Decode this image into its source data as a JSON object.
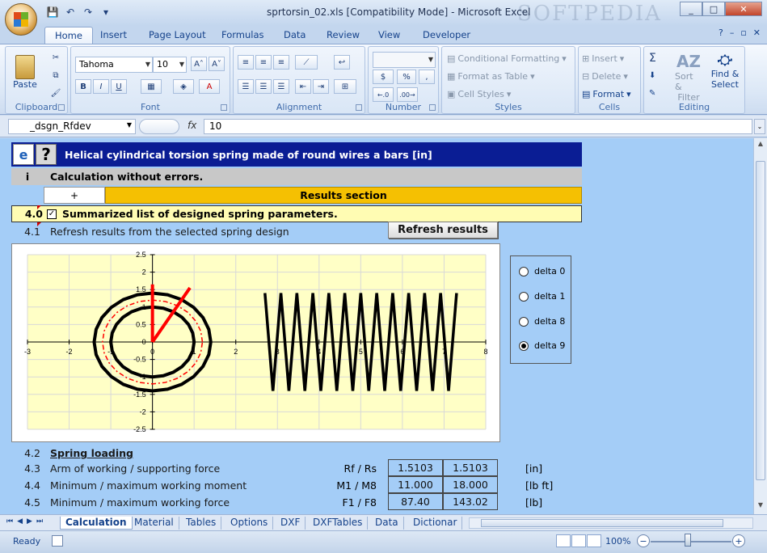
{
  "window": {
    "title": "sprtorsin_02.xls  [Compatibility Mode] - Microsoft Excel",
    "watermark": "SOFTPEDIA"
  },
  "qat": {
    "save": "💾",
    "undo": "↶",
    "redo": "↷",
    "more": "▾"
  },
  "ribbon_tabs": [
    "Home",
    "Insert",
    "Page Layout",
    "Formulas",
    "Data",
    "Review",
    "View",
    "Developer"
  ],
  "clipboard": {
    "paste": "Paste",
    "label": "Clipboard"
  },
  "font": {
    "name": "Tahoma",
    "size": "10",
    "grow": "A˄",
    "shrink": "A˅",
    "bold": "B",
    "italic": "I",
    "underline": "U",
    "borders": "▦",
    "fill": "◈",
    "color": "A",
    "label": "Font"
  },
  "alignment": {
    "label": "Alignment"
  },
  "number": {
    "format": "",
    "currency": "$",
    "percent": "%",
    "comma": ",",
    "inc": "←.0",
    "dec": ".00→",
    "label": "Number"
  },
  "styles": {
    "conditional": "Conditional Formatting",
    "table": "Format as Table",
    "cell": "Cell Styles",
    "label": "Styles"
  },
  "cells": {
    "insert": "Insert",
    "delete": "Delete",
    "format": "Format",
    "label": "Cells"
  },
  "editing": {
    "sigma": "Σ",
    "sort": "Sort &",
    "filter": "Filter",
    "find": "Find &",
    "select": "Select",
    "label": "Editing"
  },
  "formula_bar": {
    "name_box": "_dsgn_Rfdev",
    "fx": "fx",
    "value": "10"
  },
  "sheet": {
    "header_title": "Helical cylindrical torsion spring made of round wires a bars [in]",
    "icon_e": "e",
    "icon_q": "?",
    "status_marker": "i",
    "status_text": "Calculation without errors.",
    "plus": "+",
    "results_section": "Results section",
    "summary_num": "4.0",
    "summary_check": "✓",
    "summary_text": "Summarized list of designed spring parameters.",
    "row41_num": "4.1",
    "row41_text": "Refresh results from the selected spring design",
    "refresh_button": "Refresh results",
    "row42_num": "4.2",
    "row42_text": "Spring loading",
    "row43_num": "4.3",
    "row43_text": "Arm of working / supporting force",
    "row43_sym": "Rf / Rs",
    "row43_v1": "1.5103",
    "row43_v2": "1.5103",
    "row43_unit": "[in]",
    "row44_num": "4.4",
    "row44_text": "Minimum / maximum working moment",
    "row44_sym": "M1 / M8",
    "row44_v1": "11.000",
    "row44_v2": "18.000",
    "row44_unit": "[lb ft]",
    "row45_num": "4.5",
    "row45_text": "Minimum / maximum working force",
    "row45_sym": "F1 / F8",
    "row45_v1": "87.40",
    "row45_v2": "143.02",
    "row45_unit": "[lb]"
  },
  "radio_options": [
    {
      "label": "delta 0",
      "selected": false
    },
    {
      "label": "delta 1",
      "selected": false
    },
    {
      "label": "delta 8",
      "selected": false
    },
    {
      "label": "delta 9",
      "selected": true
    }
  ],
  "chart_data": {
    "type": "line",
    "xlim": [
      -3,
      8
    ],
    "ylim": [
      -2.5,
      2.5
    ],
    "x_ticks": [
      "-3",
      "-2",
      "-1",
      "0",
      "1",
      "2",
      "3",
      "4",
      "5",
      "6",
      "7",
      "8"
    ],
    "y_ticks": [
      "2.5",
      "2",
      "1.5",
      "1",
      "0.5",
      "0",
      "-0.5",
      "-1",
      "-1.5",
      "-2",
      "-2.5"
    ],
    "grid": true,
    "outer_circle_radius": 1.4,
    "inner_circle_radius": 1.0,
    "mean_circle_radius": 1.2,
    "leg1": [
      [
        0,
        0
      ],
      [
        0,
        1.65
      ]
    ],
    "leg2": [
      [
        0,
        0
      ],
      [
        0.9,
        1.55
      ]
    ],
    "coil_x_range": [
      2.7,
      7.3
    ],
    "coil_turns": 12,
    "coil_amplitude": 1.4,
    "colors": {
      "plot_bg": "#ffffc6",
      "spring": "#000000",
      "legs": "#ff0000"
    }
  },
  "sheet_tabs": [
    "Calculation",
    "Material",
    "Tables",
    "Options",
    "DXF",
    "DXFTables",
    "Data",
    "Dictionar"
  ],
  "status": {
    "ready": "Ready",
    "zoom": "100%"
  }
}
